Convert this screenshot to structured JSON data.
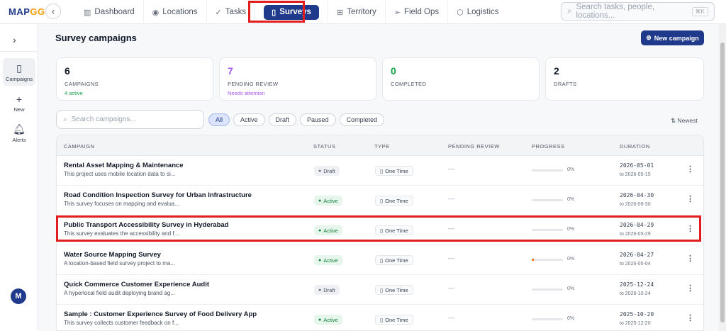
{
  "logo": {
    "main": "MAP",
    "accent": "GG"
  },
  "nav": [
    {
      "label": "Dashboard",
      "icon": "bar-chart-icon"
    },
    {
      "label": "Locations",
      "icon": "map-pin-icon"
    },
    {
      "label": "Tasks",
      "icon": "check-icon"
    },
    {
      "label": "Surveys",
      "icon": "clipboard-icon",
      "active": true
    },
    {
      "label": "Territory",
      "icon": "map-icon"
    },
    {
      "label": "Field Ops",
      "icon": "send-icon"
    },
    {
      "label": "Logistics",
      "icon": "package-icon"
    }
  ],
  "top_search": {
    "placeholder": "Search tasks, people, locations...",
    "shortcut": "⌘K"
  },
  "rail": {
    "campaigns": "Campaigns",
    "new": "New",
    "alerts": "Alerts",
    "avatar": "M"
  },
  "page": {
    "title": "Survey campaigns",
    "new_button": "New campaign"
  },
  "stats": [
    {
      "value": "6",
      "label": "CAMPAIGNS",
      "sub": "4 active",
      "color": "#16a34a",
      "sub_color": "#16a34a"
    },
    {
      "value": "7",
      "label": "PENDING REVIEW",
      "sub": "Needs attention",
      "color": "#a855f7",
      "sub_color": "#a855f7"
    },
    {
      "value": "0",
      "label": "COMPLETED",
      "sub": "",
      "color": "#16a34a",
      "sub_color": "#16a34a"
    },
    {
      "value": "2",
      "label": "DRAFTS",
      "sub": "",
      "color": "#111827",
      "sub_color": "#6b7280"
    }
  ],
  "campaign_search": {
    "placeholder": "Search campaigns..."
  },
  "filters": [
    "All",
    "Active",
    "Draft",
    "Paused",
    "Completed"
  ],
  "sort_label": "⇅ Newest",
  "table": {
    "headers": [
      "CAMPAIGN",
      "STATUS",
      "TYPE",
      "PENDING REVIEW",
      "PROGRESS",
      "DURATION"
    ],
    "rows": [
      {
        "name": "Rental Asset Mapping & Maintenance",
        "desc": "This project uses mobile location data to si...",
        "status": "Draft",
        "type": "One Time",
        "pending": "—",
        "progress": 0,
        "progress_label": "0%",
        "start": "2026-05-01",
        "end": "to 2026-05-15"
      },
      {
        "name": "Road Condition Inspection Survey for Urban Infrastructure",
        "desc": "This survey focuses on mapping and evalua...",
        "status": "Active",
        "type": "One Time",
        "pending": "—",
        "progress": 0,
        "progress_label": "0%",
        "start": "2026-04-30",
        "end": "to 2026-06-30"
      },
      {
        "name": "Public Transport Accessibility Survey in Hyderabad",
        "desc": "This survey evaluates the accessibility and f...",
        "status": "Active",
        "type": "One Time",
        "pending": "—",
        "progress": 0,
        "progress_label": "0%",
        "start": "2026-04-29",
        "end": "to 2026-05-29"
      },
      {
        "name": "Water Source Mapping Survey",
        "desc": "A location-based field survey project to ma...",
        "status": "Active",
        "type": "One Time",
        "pending": "—",
        "progress": 0.06,
        "progress_label": "0%",
        "start": "2026-04-27",
        "end": "to 2026-05-04"
      },
      {
        "name": "Quick Commerce Customer Experience Audit",
        "desc": "A hyperlocal field audit deploying brand ag...",
        "status": "Draft",
        "type": "One Time",
        "pending": "—",
        "progress": 0,
        "progress_label": "0%",
        "start": "2025-12-24",
        "end": "to 2026-10-24"
      },
      {
        "name": "Sample : Customer Experience Survey of Food Delivery App",
        "desc": "This survey collects customer feedback on f...",
        "status": "Active",
        "type": "One Time",
        "pending": "—",
        "progress": 0,
        "progress_label": "0%",
        "start": "2025-10-20",
        "end": "to 2025-12-20"
      }
    ]
  }
}
